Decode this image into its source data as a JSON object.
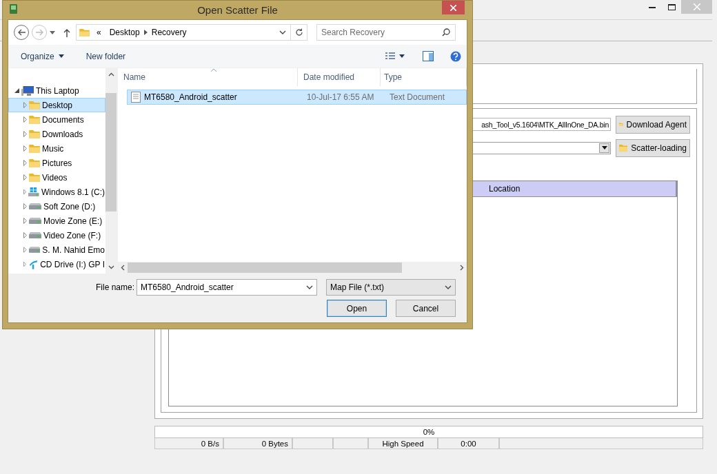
{
  "app": {
    "download_agent": {
      "path": "ash_Tool_v5.1604\\MTK_AllInOne_DA.bin",
      "button": "Download Agent"
    },
    "scatter": {
      "button": "Scatter-loading"
    },
    "table": {
      "columns": [
        "Location"
      ]
    },
    "progress": {
      "label": "0%",
      "level": 0
    },
    "status": [
      {
        "kind": "right",
        "text": "0 B/s"
      },
      {
        "kind": "right",
        "text": "0 Bytes"
      },
      {
        "kind": "blank"
      },
      {
        "kind": "blank"
      },
      {
        "kind": "center",
        "text": "High Speed"
      },
      {
        "kind": "center",
        "text": "0:00"
      },
      {
        "kind": "blank"
      }
    ]
  },
  "dialog": {
    "title": "Open Scatter File",
    "address": {
      "overflow": "«",
      "crumbs": [
        "Desktop",
        "Recovery"
      ]
    },
    "search": {
      "placeholder": "Search Recovery"
    },
    "toolbar": {
      "organize": "Organize",
      "new_folder": "New folder"
    },
    "nav_tree": [
      {
        "label": "This Laptop",
        "kind": "computer",
        "expanded": true,
        "selected": false,
        "children": [
          {
            "label": "Desktop",
            "kind": "folder",
            "expanded": false,
            "selected": true
          },
          {
            "label": "Documents",
            "kind": "folder",
            "expanded": false,
            "selected": false
          },
          {
            "label": "Downloads",
            "kind": "folder",
            "expanded": false,
            "selected": false
          },
          {
            "label": "Music",
            "kind": "folder",
            "expanded": false,
            "selected": false
          },
          {
            "label": "Pictures",
            "kind": "folder",
            "expanded": false,
            "selected": false
          },
          {
            "label": "Videos",
            "kind": "folder",
            "expanded": false,
            "selected": false
          },
          {
            "label": "Windows 8.1 (C:)",
            "kind": "system-drive",
            "expanded": false,
            "selected": false
          },
          {
            "label": "Soft Zone (D:)",
            "kind": "drive",
            "expanded": false,
            "selected": false
          },
          {
            "label": "Movie Zone (E:)",
            "kind": "drive",
            "expanded": false,
            "selected": false
          },
          {
            "label": "Video Zone (F:)",
            "kind": "drive",
            "expanded": false,
            "selected": false
          },
          {
            "label": "S. M. Nahid Emo",
            "kind": "drive",
            "expanded": false,
            "selected": false
          },
          {
            "label": "CD Drive (I:) GP I",
            "kind": "modem",
            "expanded": false,
            "selected": false
          }
        ]
      }
    ],
    "columns": [
      "Name",
      "Date modified",
      "Type"
    ],
    "files": [
      {
        "name": "MT6580_Android_scatter",
        "date": "10-Jul-17 6:55 AM",
        "type": "Text Document",
        "selected": true
      }
    ],
    "file_name": {
      "label": "File name:",
      "value": "MT6580_Android_scatter"
    },
    "filter": "Map File (*.txt)",
    "buttons": [
      {
        "label": "Open",
        "default": true
      },
      {
        "label": "Cancel",
        "default": false
      }
    ]
  }
}
